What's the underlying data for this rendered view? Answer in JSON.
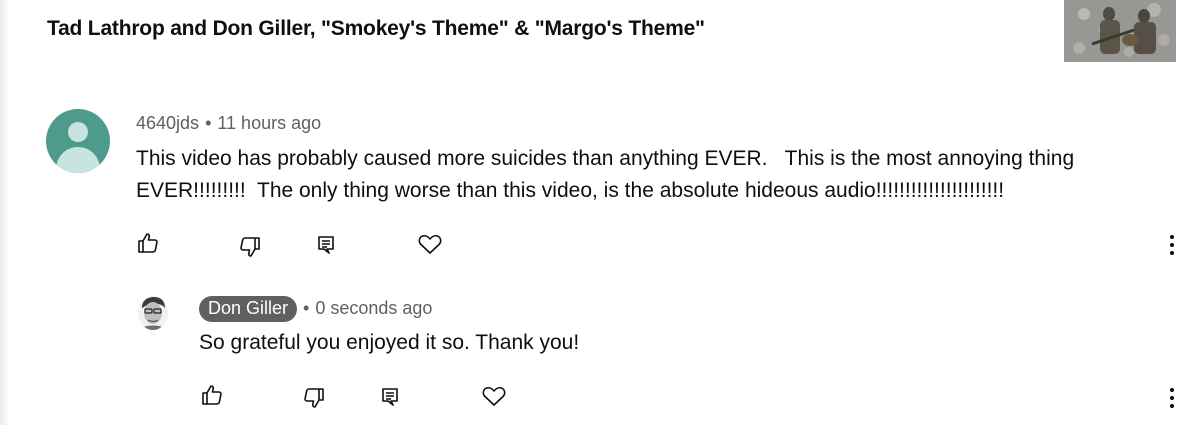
{
  "video": {
    "title": "Tad Lathrop and Don Giller, \"Smokey's Theme\" & \"Margo's Theme\""
  },
  "comments": [
    {
      "author": "4640jds",
      "time": "11 hours ago",
      "separator": "•",
      "text": "This video has probably caused more suicides than anything EVER.   This is the most annoying thing EVER!!!!!!!!!  The only thing worse than this video, is the absolute hideous audio!!!!!!!!!!!!!!!!!!!!!!"
    }
  ],
  "reply": {
    "author": "Don Giller",
    "time": "0 seconds ago",
    "separator": "•",
    "text": "So grateful you enjoyed it so. Thank you!"
  },
  "icons": {
    "like": "thumbs-up-icon",
    "dislike": "thumbs-down-icon",
    "reply": "reply-icon",
    "heart": "heart-icon",
    "more": "more-vertical-icon"
  },
  "colors": {
    "avatar": "#4e9b8d",
    "meta_text": "#606060",
    "author_chip": "#606060"
  }
}
